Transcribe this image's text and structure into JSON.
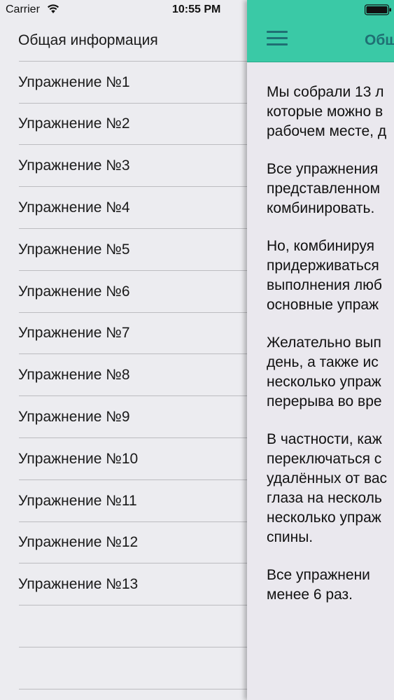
{
  "status_bar": {
    "carrier": "Carrier",
    "time": "10:55 PM"
  },
  "menu": {
    "items": [
      {
        "label": "Общая информация"
      },
      {
        "label": "Упражнение №1"
      },
      {
        "label": "Упражнение №2"
      },
      {
        "label": "Упражнение №3"
      },
      {
        "label": "Упражнение №4"
      },
      {
        "label": "Упражнение №5"
      },
      {
        "label": "Упражнение №6"
      },
      {
        "label": "Упражнение №7"
      },
      {
        "label": "Упражнение №8"
      },
      {
        "label": "Упражнение №9"
      },
      {
        "label": "Упражнение №10"
      },
      {
        "label": "Упражнение №11"
      },
      {
        "label": "Упражнение №12"
      },
      {
        "label": "Упражнение №13"
      },
      {
        "label": ""
      },
      {
        "label": ""
      }
    ]
  },
  "header": {
    "title": "Общ"
  },
  "content": {
    "paragraphs": [
      {
        "lines": [
          " Мы собрали 13 л",
          "которые можно в",
          "рабочем месте, д"
        ]
      },
      {
        "lines": [
          " Все упражнения",
          "представленном",
          "комбинировать."
        ]
      },
      {
        "lines": [
          " Но, комбинируя",
          "придерживаться",
          "выполнения люб",
          "основные упраж"
        ]
      },
      {
        "lines": [
          " Желательно вып",
          "день, а также ис",
          "несколько упраж",
          "перерыва во вре"
        ]
      },
      {
        "lines": [
          " В частности, каж",
          "переключаться с",
          "удалённых от вас",
          "глаза на несколь",
          "несколько упраж",
          "спины."
        ]
      },
      {
        "lines": [
          "  Все упражнени",
          "менее 6 раз."
        ]
      }
    ]
  },
  "colors": {
    "header_bg": "#3ac9a6",
    "header_fg": "#1f6f73",
    "menu_bg": "#ececf0",
    "content_bg": "#eae8ee"
  }
}
